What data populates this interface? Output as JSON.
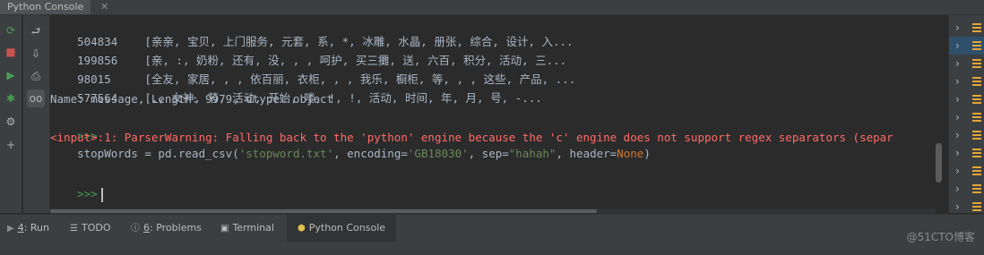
{
  "window": {
    "title": "Python Console",
    "close_glyph": "✕"
  },
  "left_strip": {
    "icons": [
      {
        "name": "rerun-icon",
        "glyph": "⟳",
        "color": "#499c54"
      },
      {
        "name": "stop-icon",
        "glyph": "■",
        "color": "#c75450"
      },
      {
        "name": "run-icon",
        "glyph": "▶",
        "color": "#499c54"
      },
      {
        "name": "debug-icon",
        "glyph": "✱",
        "color": "#499c54"
      },
      {
        "name": "settings-icon",
        "glyph": "⚙",
        "color": "#afb1b3"
      },
      {
        "name": "add-icon",
        "glyph": "+",
        "color": "#afb1b3"
      }
    ]
  },
  "gutter": {
    "icons": [
      {
        "name": "soft-wrap-icon",
        "glyph": "⮐"
      },
      {
        "name": "scroll-to-end-icon",
        "glyph": "⇩"
      },
      {
        "name": "print-icon",
        "glyph": "⎙"
      },
      {
        "name": "show-variables-icon",
        "glyph": "oo"
      }
    ]
  },
  "console": {
    "rows": [
      {
        "index": "504834",
        "text": "[亲亲, 宝贝, 上门服务, 元套, 系, *, 冰雕, 水晶, 册张, 综合, 设计, 入..."
      },
      {
        "index": "199856",
        "text": "[亲, :, 奶粉, 还有, 没, , , 呵护, 买三攤, 送, 六百, 积分, 活动, 三..."
      },
      {
        "index": "98015",
        "text": "[全友, 家居, , , 依百丽, 衣柜, , , 我乐, 橱柜, 等, , , 这些, 产品, ..."
      },
      {
        "index": "577564",
        "text": "[., 女神, 节, 活动, 开始, 喽, !, !, 活动, 时间, 年, 月, 号, -..."
      }
    ],
    "summary": "Name: message, Length: 9979, dtype: object",
    "prompt": ">>>",
    "command": {
      "p1": "stopWords = pd.read_csv(",
      "s1": "'stopword.txt'",
      "p2": ", encoding=",
      "s2": "'GB18030'",
      "p3": ", sep=",
      "s3": "\"hahah\"",
      "p4": ", header=",
      "kw": "None",
      "p5": ")"
    },
    "warning": "<input>:1: ParserWarning: Falling back to the 'python' engine because the 'c' engine does not support regex separators (separ",
    "input_prompt": ">>>"
  },
  "var_panel": {
    "row_count": 11,
    "selected_index": 1,
    "chevron": "›"
  },
  "bottom_tabs": [
    {
      "name": "tab-run",
      "icon": "▶",
      "mnemonic": "4",
      "label": ": Run",
      "active": false
    },
    {
      "name": "tab-todo",
      "icon": "☰",
      "mnemonic": "",
      "label": "TODO",
      "active": false
    },
    {
      "name": "tab-problems",
      "icon": "ⓘ",
      "mnemonic": "6",
      "label": ": Problems",
      "active": false
    },
    {
      "name": "tab-terminal",
      "icon": "▣",
      "mnemonic": "",
      "label": "Terminal",
      "active": false
    },
    {
      "name": "tab-python-console",
      "icon": "⬢",
      "mnemonic": "",
      "label": "Python Console",
      "active": true
    }
  ],
  "watermark": "@51CTO博客"
}
